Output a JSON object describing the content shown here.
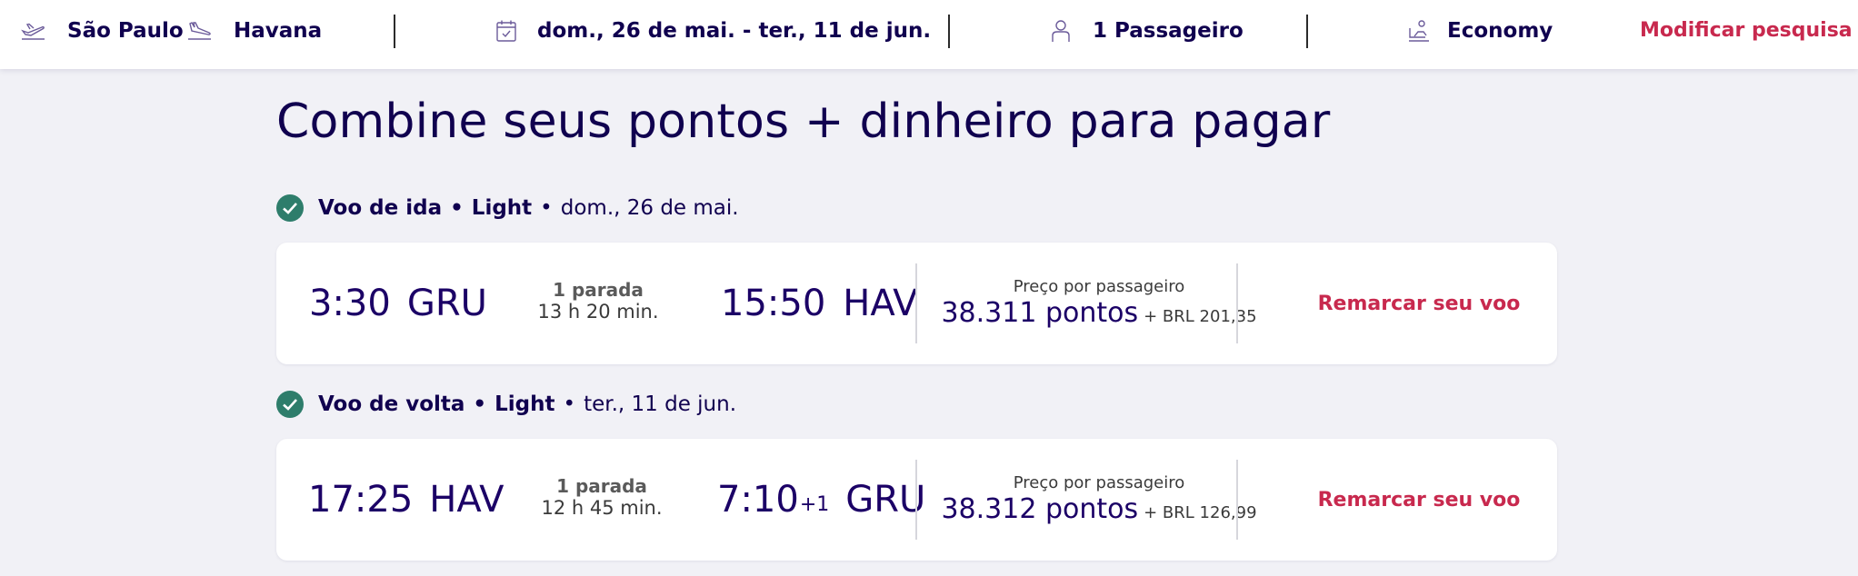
{
  "search_bar": {
    "origin": "São Paulo",
    "destination": "Havana",
    "dates": "dom., 26 de mai. - ter., 11 de jun.",
    "passengers": "1 Passageiro",
    "cabin": "Economy",
    "modify_label": "Modificar pesquisa",
    "icons": [
      "plane-takeoff-icon",
      "plane-landing-icon",
      "calendar-icon",
      "person-icon",
      "seat-icon",
      "chevron-down-icon"
    ]
  },
  "page": {
    "title": "Combine seus pontos + dinheiro para pagar"
  },
  "colors": {
    "navy": "#10004f",
    "accent": "#c8294e",
    "check_green": "#2e7d6b",
    "background": "#f1f1f6"
  },
  "flights": [
    {
      "direction": "Voo de ida",
      "fare": "Light",
      "date": "dom., 26 de mai.",
      "dep_time": "3:30",
      "dep_code": "GRU",
      "stops": "1 parada",
      "duration": "13 h 20 min.",
      "arr_time": "15:50",
      "arr_day_offset": "",
      "arr_code": "HAV",
      "price_label": "Preço por passageiro",
      "points": "38.311 pontos",
      "cash": "+ BRL 201,35",
      "action": "Remarcar seu voo"
    },
    {
      "direction": "Voo de volta",
      "fare": "Light",
      "date": "ter., 11 de jun.",
      "dep_time": "17:25",
      "dep_code": "HAV",
      "stops": "1 parada",
      "duration": "12 h 45 min.",
      "arr_time": "7:10",
      "arr_day_offset": "+1",
      "arr_code": "GRU",
      "price_label": "Preço por passageiro",
      "points": "38.312 pontos",
      "cash": "+ BRL 126,99",
      "action": "Remarcar seu voo"
    }
  ]
}
